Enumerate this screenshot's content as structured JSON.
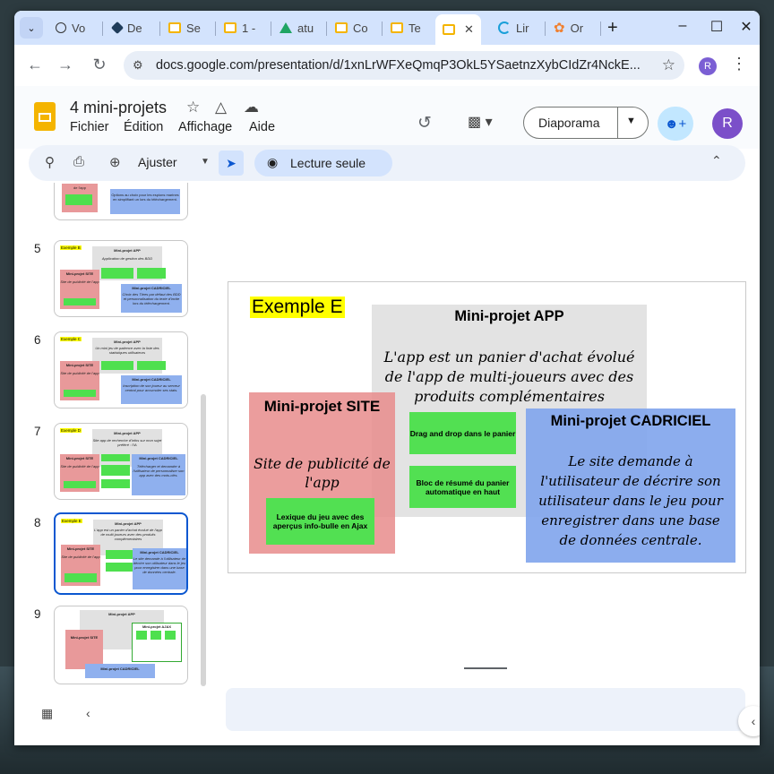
{
  "browser": {
    "tabs": [
      {
        "label": "Vo",
        "icon": "chatgpt-icon"
      },
      {
        "label": "De",
        "icon": "hexagon-icon"
      },
      {
        "label": "Se",
        "icon": "slides-icon"
      },
      {
        "label": "1 -",
        "icon": "slides-icon"
      },
      {
        "label": "atu",
        "icon": "drive-icon"
      },
      {
        "label": "Co",
        "icon": "slides-icon"
      },
      {
        "label": "Te",
        "icon": "slides-icon"
      },
      {
        "label": "",
        "icon": "slides-icon",
        "active": true
      },
      {
        "label": "Lir",
        "icon": "lin-icon"
      },
      {
        "label": "Or",
        "icon": "flower-icon"
      }
    ],
    "close_glyph": "✕",
    "new_tab_glyph": "+",
    "url": "docs.google.com/presentation/d/1xnLrWFXeQmqP3OkL5YSaetnzXybCIdZr4NckE...",
    "profile_initial": "R"
  },
  "app": {
    "title": "4 mini-projets",
    "menus": [
      "Fichier",
      "Édition",
      "Affichage",
      "Aide"
    ],
    "present_label": "Diaporama",
    "user_initial": "R",
    "zoom_label": "Ajuster",
    "readonly_label": "Lecture seule"
  },
  "filmstrip": {
    "slides": [
      {
        "number": "5",
        "tag": "Exemple B",
        "app_title": "Mini-projet APP",
        "app_desc": "Application de gestion des BDD",
        "site_title": "Mini-projet SITE",
        "site_desc": "Site de publicité de l'app",
        "cad_title": "Mini-projet CADRICIEL",
        "cad_desc": "Choix des Titres par défaut des BDD et personnalisation du texte d'invite lors du téléchargement."
      },
      {
        "number": "6",
        "tag": "Exemple C",
        "app_title": "Mini-projet APP",
        "app_desc": "Un mini jeu de patience avec la liste des statistiques utilisateurs",
        "site_title": "Mini-projet SITE",
        "site_desc": "Site de publicité de l'app",
        "cad_title": "Mini-projet CADRICIEL",
        "cad_desc": "Inscription de son joueur au serveur central pour accumuler ses stats."
      },
      {
        "number": "7",
        "tag": "Exemple D",
        "app_title": "Mini-projet APP",
        "app_desc": "Site app de recherche d'infos sur mon sujet préféré : l'IA",
        "site_title": "Mini-projet SITE",
        "site_desc": "Site de publicité de l'app",
        "cad_title": "Mini-projet CADRICIEL",
        "cad_desc": "Télécharger et demander à l'utilisateur de personnaliser son app avec des mots-clés."
      },
      {
        "number": "8",
        "tag": "Exemple E",
        "app_title": "Mini-projet APP",
        "app_desc": "L'app est un panier d'achat évolué de l'app de multi-joueurs avec des produits complémentaires",
        "site_title": "Mini-projet SITE",
        "site_desc": "Site de publicité de l'app",
        "cad_title": "Mini-projet CADRICIEL",
        "cad_desc": "Le site demande à l'utilisateur de décrire son utilisateur dans le jeu pour enregistrer dans une base de données centrale.",
        "selected": true
      },
      {
        "number": "9",
        "tag": "",
        "app_title": "Mini-projet APP",
        "app_desc": "",
        "site_title": "Mini-projet SITE",
        "site_desc": "",
        "cad_title": "Mini-projet CADRICIEL",
        "cad_desc": "",
        "ajax_title": "Mini-projet AJAX"
      }
    ],
    "partial_top": {
      "site_desc": "de l'app",
      "cad_desc": "Options au choix pour les espions marines en simplifiant un lors du téléchargement."
    }
  },
  "slide": {
    "tag": "Exemple E",
    "app": {
      "title": "Mini-projet APP",
      "description": "L'app est un panier d'achat évolué de l'app de multi-joueurs avec des produits complémentaires",
      "features": [
        "Drag and drop dans le panier",
        "Bloc de résumé du panier automatique en haut"
      ]
    },
    "site": {
      "title": "Mini-projet SITE",
      "description": "Site de publicité de l'app",
      "features": [
        "Lexique du jeu avec des aperçus info-bulle en Ajax"
      ]
    },
    "cadriciel": {
      "title": "Mini-projet CADRICIEL",
      "description": "Le site demande à l'utilisateur de décrire son utilisateur dans le jeu pour enregistrer dans une base de données centrale."
    }
  },
  "colors": {
    "accent": "#0b57d0",
    "tag_yellow": "#ffff00",
    "app_grey": "#e3e3e3",
    "site_red": "#e88c8c",
    "cad_blue": "#80a4ec",
    "feature_green": "#52e052"
  }
}
